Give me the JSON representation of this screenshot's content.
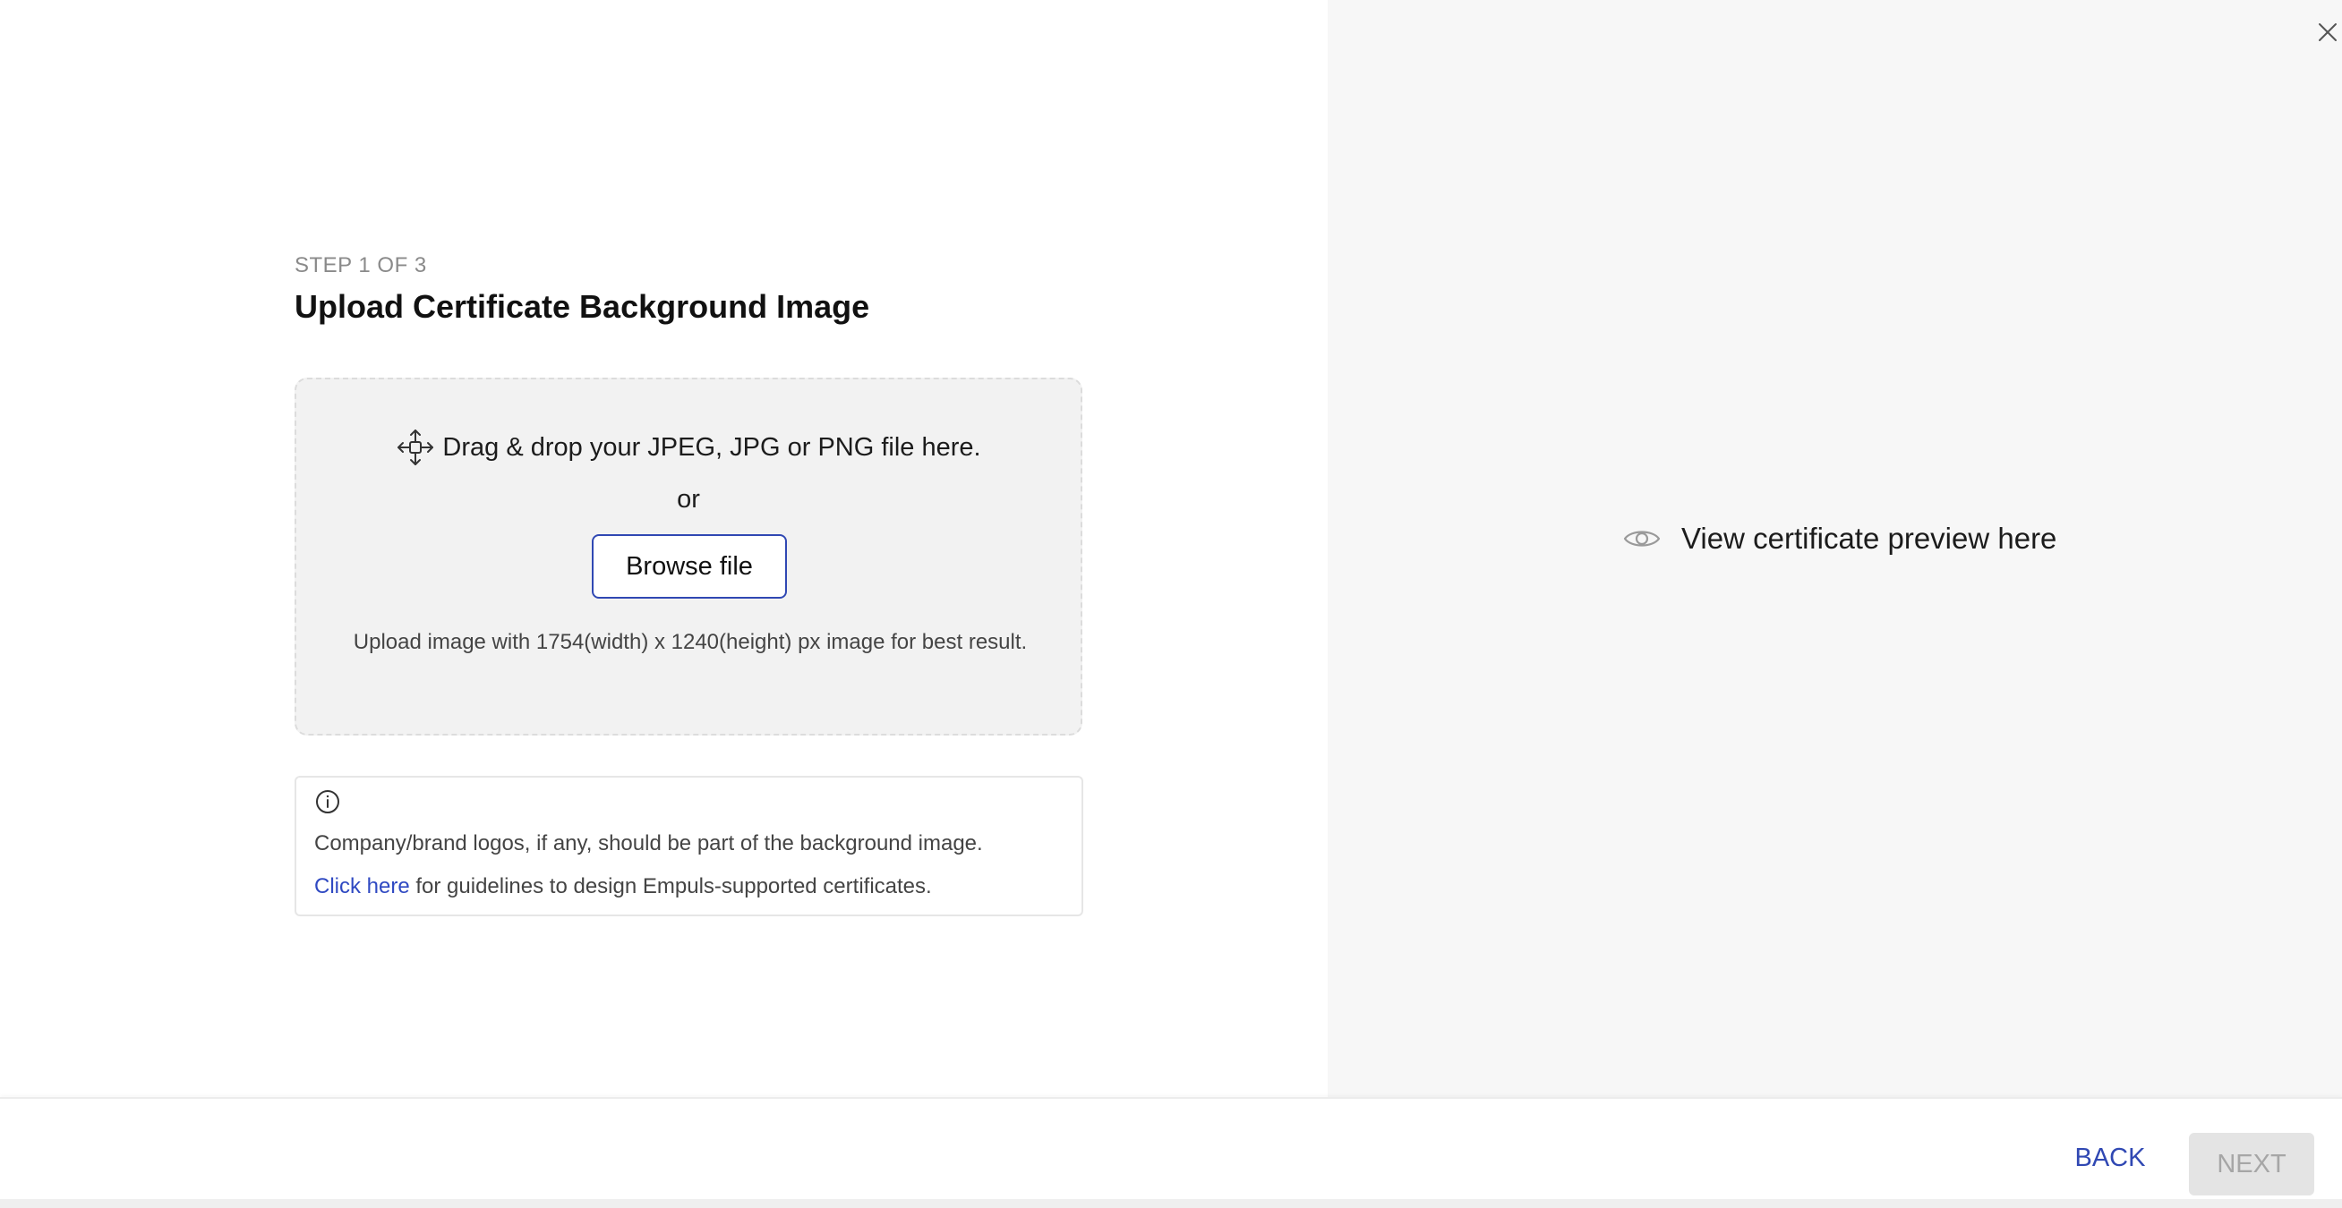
{
  "wizard": {
    "step_label": "STEP 1 OF 3",
    "title": "Upload Certificate Background Image"
  },
  "dropzone": {
    "icon": "move-icon",
    "instruction": "Drag & drop your JPEG, JPG or PNG file here.",
    "or_text": "or",
    "browse_label": "Browse file",
    "hint": "Upload image with 1754(width) x 1240(height) px image for best result."
  },
  "info": {
    "icon": "info-icon",
    "line1": "Company/brand logos, if any, should be part of the background image.",
    "link_text": "Click here",
    "line2_rest": " for guidelines to design Empuls-supported certificates."
  },
  "preview": {
    "icon": "eye-icon",
    "text": "View certificate preview here"
  },
  "footer": {
    "back_label": "BACK",
    "next_label": "NEXT"
  },
  "colors": {
    "accent": "#3048b3",
    "link": "#2f49c2",
    "preview_bg": "#f7f7f7",
    "dropzone_bg": "#f2f2f2",
    "disabled_bg": "#e4e4e4"
  }
}
